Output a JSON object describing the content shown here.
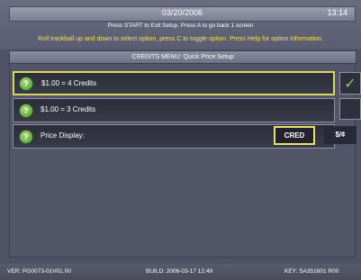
{
  "header": {
    "date": "03/20/2006",
    "time": "13:14",
    "instruction_exit": "Press START to Exit Setup. Press A to go back 1 screen",
    "instruction_nav": "Roll trackball up and down to select option, press C to toggle option. Press Help for option information."
  },
  "menu": {
    "title": "CREDITS MENU: Quick Price Setup",
    "options": [
      {
        "label": "$1.00 = 4 Credits",
        "icon": "help-icon",
        "selected": true
      },
      {
        "label": "$1.00 = 3 Credits",
        "icon": "help-icon",
        "selected": false
      },
      {
        "label": "Price Display:",
        "icon": "help-icon",
        "selected": false
      }
    ],
    "price_display_values": [
      "CRED",
      "$/¢"
    ],
    "price_display_selected": "CRED"
  },
  "check_icon": "check-icon",
  "help_glyph": "?",
  "check_glyph": "✓",
  "footer": {
    "version": "VER: PG0073-01V01.00",
    "build": "BUILD: 2006-03-17 12:49",
    "key": "KEY: SA351601 R00"
  },
  "colors": {
    "background": "#505266",
    "instruction_yellow": "#f2e15a",
    "selection_border": "#d8d85c",
    "check_green": "#7ed848",
    "help_green": "#4e9a2e"
  }
}
